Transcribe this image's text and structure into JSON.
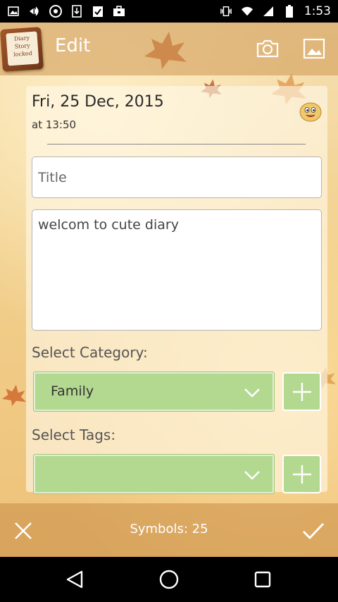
{
  "status_bar": {
    "time": "1:53",
    "left_icons": [
      "image-icon",
      "cast-icon",
      "aperture-icon",
      "download-icon",
      "clipboard-check-icon",
      "briefcase-icon"
    ],
    "right_icons": [
      "vibrate-icon",
      "wifi-icon",
      "signal-icon",
      "battery-icon"
    ]
  },
  "app_bar": {
    "title": "Edit",
    "logo_lines": [
      "Diary",
      "Story",
      "locked"
    ],
    "actions": [
      "camera-icon",
      "gallery-icon"
    ]
  },
  "entry": {
    "date": "Fri, 25 Dec, 2015",
    "time": "at 13:50",
    "mood_icon": "smiley-icon",
    "title_placeholder": "Title",
    "title_value": "",
    "body_text": "welcom to cute diary"
  },
  "category": {
    "label": "Select Category:",
    "selected": "Family",
    "add_icon": "plus-icon"
  },
  "tags": {
    "label": "Select Tags:",
    "selected": "",
    "add_icon": "plus-icon"
  },
  "bottom_bar": {
    "symbols_label": "Symbols: 25",
    "cancel_icon": "close-icon",
    "confirm_icon": "check-icon"
  },
  "nav_bar": {
    "buttons": [
      "back-icon",
      "home-icon",
      "recents-icon"
    ]
  },
  "colors": {
    "accent_green": "#b3d890",
    "bar_overlay": "#cd9650"
  }
}
